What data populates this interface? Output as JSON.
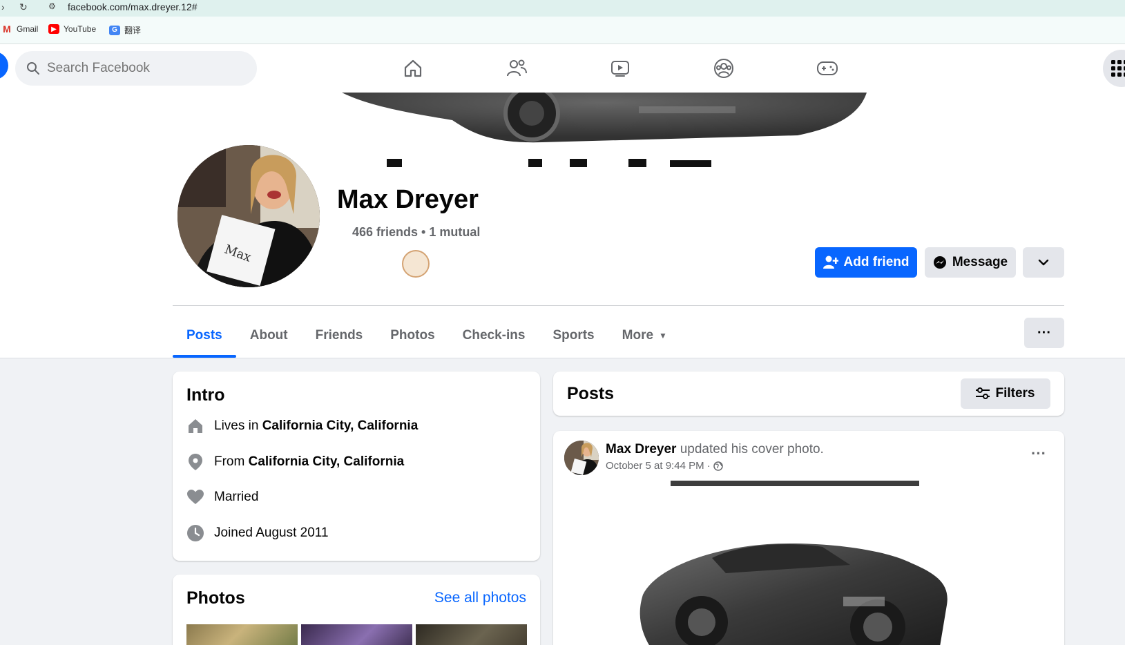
{
  "browser": {
    "url": "facebook.com/max.dreyer.12#",
    "bookmarks": [
      "Gmail",
      "YouTube",
      "翻译"
    ]
  },
  "nav": {
    "search_placeholder": "Search Facebook",
    "tabs": [
      "home-icon",
      "friends-icon",
      "watch-icon",
      "groups-icon",
      "gaming-icon"
    ]
  },
  "profile": {
    "name": "Max Dreyer",
    "friends": "466 friends • 1 mutual",
    "add_friend": "Add friend",
    "message": "Message"
  },
  "tabs": [
    "Posts",
    "About",
    "Friends",
    "Photos",
    "Check-ins",
    "Sports",
    "More"
  ],
  "intro": {
    "title": "Intro",
    "lives_prefix": "Lives in",
    "lives_place": "California City, California",
    "from_prefix": "From",
    "from_place": "California City, California",
    "relationship": "Married",
    "joined": "Joined August 2011"
  },
  "photos": {
    "title": "Photos",
    "see_all": "See all photos"
  },
  "posts": {
    "title": "Posts",
    "filters": "Filters",
    "post": {
      "author": "Max Dreyer",
      "action": "updated his cover photo.",
      "time": "October 5 at 9:44 PM ·"
    }
  },
  "colors": {
    "accent": "#0866ff",
    "background": "#f0f2f5",
    "secondary_button": "#e4e6eb"
  }
}
